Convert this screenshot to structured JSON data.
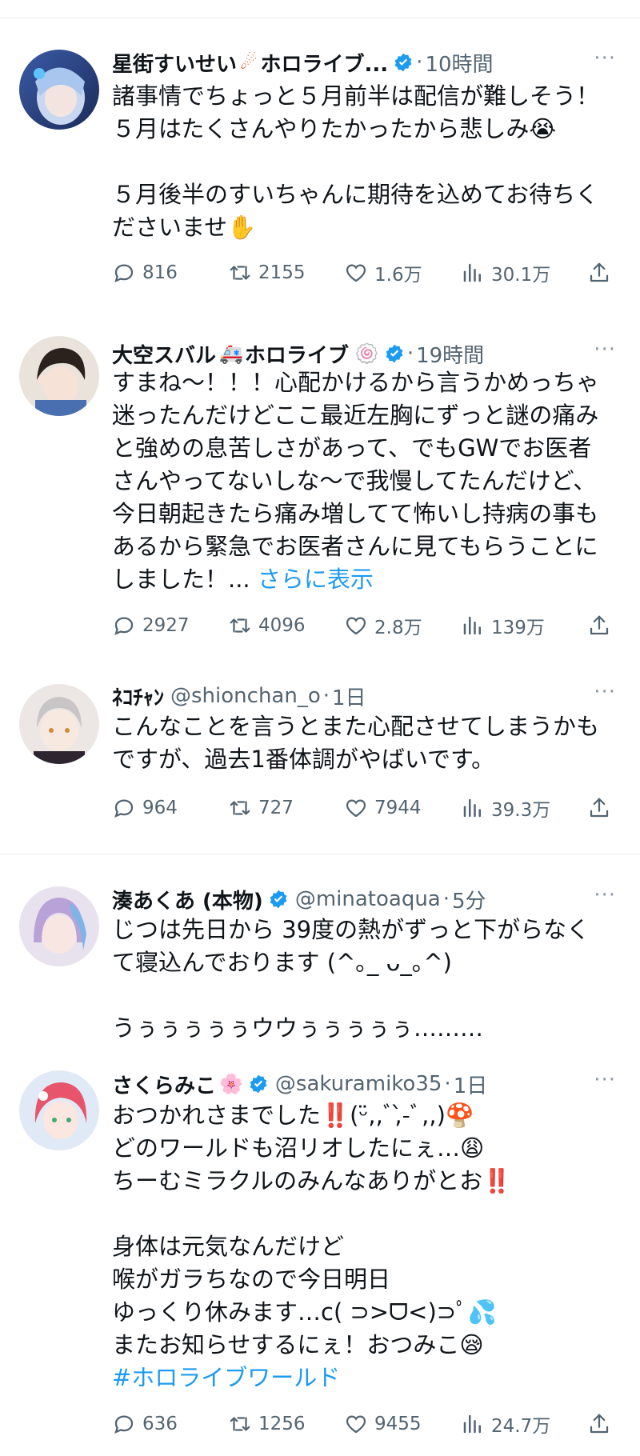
{
  "tweets": [
    {
      "name": "星街すいせい",
      "name_suffix": "ホロライブ...",
      "name_emoji": "☄",
      "handle": "",
      "time": "10時間",
      "lines": [
        "諸事情でちょっと５月前半は配信が難しそう！",
        "５月はたくさんやりたかったから悲しみ😭",
        "",
        "５月後半のすいちゃんに期待を込めてお待ちく",
        "ださいませ✋"
      ],
      "replies": "816",
      "retweets": "2155",
      "likes": "1.6万",
      "views": "30.1万"
    },
    {
      "name": "大空スバル",
      "name_suffix": "ホロライブ",
      "name_emoji": "🚑",
      "name_emoji2": "🍥",
      "handle": "",
      "time": "19時間",
      "lines": [
        "すまね〜！！！心配かけるから言うかめっちゃ",
        "迷ったんだけどここ最近左胸にずっと謎の痛み",
        "と強めの息苦しさがあって、でもGWでお医者",
        "さんやってないしな〜で我慢してたんだけど、",
        "今日朝起きたら痛み増してて怖いし持病の事も",
        "あるから緊急でお医者さんに見てもらうことに",
        "しました！..."
      ],
      "show_more": "さらに表示",
      "replies": "2927",
      "retweets": "4096",
      "likes": "2.8万",
      "views": "139万"
    },
    {
      "name": "ﾈｺﾁｬﾝ",
      "handle": "@shionchan_o",
      "time": "1日",
      "lines": [
        "こんなことを言うとまた心配させてしまうかも",
        "ですが、過去1番体調がやばいです。"
      ],
      "replies": "964",
      "retweets": "727",
      "likes": "7944",
      "views": "39.3万"
    },
    {
      "name": "湊あくあ (本物)",
      "handle": "@minatoaqua",
      "time": "5分",
      "lines": [
        "じつは先日から 39度の熱がずっと下がらなく",
        "て寝込んでおります (^｡_ ᴗ_｡^)",
        "",
        "うぅぅぅぅぅウウぅぅぅぅぅ………"
      ]
    },
    {
      "name": "さくらみこ",
      "name_emoji": "🌸",
      "handle": "@sakuramiko35",
      "time": "1日",
      "lines": [
        "おつかれさまでした‼️(ᵕ̈,,ﾞ,̀-ﾞ,,)🍄",
        "どのワールドも沼リオしたにぇ…😩",
        "ちーむミラクルのみんなありがとお‼️",
        "",
        "身体は元気なんだけど",
        "喉がガラちなので今日明日",
        "ゆっくり休みます…c( ⊃>ᗜ<)⊃ﾟ💦",
        "またお知らせするにぇ！おつみこ😪"
      ],
      "hashtag": "#ホロライブワールド",
      "replies": "636",
      "retweets": "1256",
      "likes": "9455",
      "views": "24.7万"
    }
  ],
  "ui": {
    "more": "···",
    "dot": "·"
  },
  "colors": {
    "verified": "#1d9bf0",
    "link": "#1d9bf0",
    "muted": "#536471"
  },
  "icons": {
    "reply": "reply-icon",
    "retweet": "retweet-icon",
    "like": "heart-icon",
    "views": "views-icon",
    "share": "share-icon",
    "verified": "verified-badge-icon",
    "more": "more-icon"
  }
}
